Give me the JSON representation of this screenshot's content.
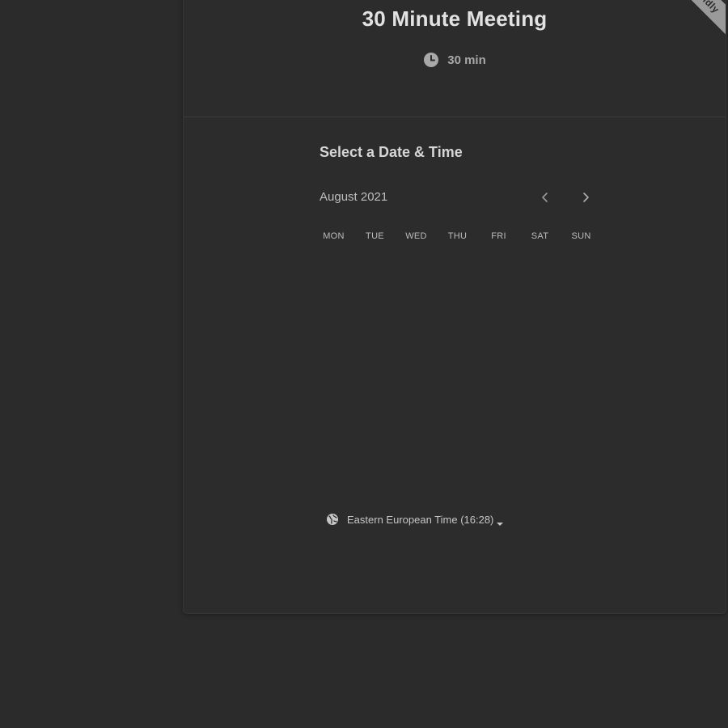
{
  "event": {
    "title": "30 Minute Meeting",
    "duration": "30 min",
    "duration_icon": "clock-icon"
  },
  "badge": {
    "text": "Calendly"
  },
  "scheduler": {
    "heading": "Select a Date & Time",
    "month": "August 2021",
    "prev_icon": "chevron-left-icon",
    "next_icon": "chevron-right-icon",
    "weekdays": [
      "MON",
      "TUE",
      "WED",
      "THU",
      "FRI",
      "SAT",
      "SUN"
    ]
  },
  "timezone": {
    "icon": "globe-icon",
    "label": "Eastern European Time (16:28)",
    "caret_icon": "caret-down-icon"
  },
  "colors": {
    "background": "#2b2b2b",
    "card": "#2c2c2c",
    "text": "#d8d8d8",
    "muted": "#9a9a9a"
  }
}
